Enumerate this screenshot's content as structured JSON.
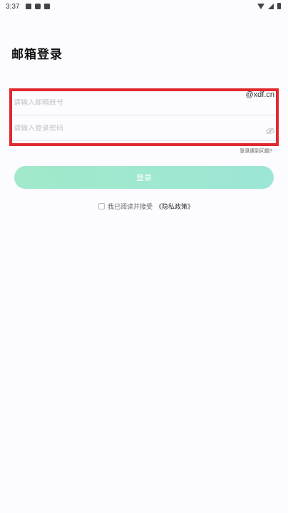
{
  "status_bar": {
    "time": "3:37",
    "left_icons": [
      "gallery-icon",
      "notification-icon",
      "sim-icon"
    ],
    "right_icons": [
      "wifi-icon",
      "signal-icon",
      "battery-icon"
    ]
  },
  "header": {
    "title": "邮箱登录"
  },
  "form": {
    "email_placeholder": "请输入邮箱账号",
    "email_value": "",
    "email_suffix": "@xdf.cn",
    "password_placeholder": "请输入登录密码",
    "password_value": "",
    "password_toggle_icon": "eye-off-icon",
    "trouble_link": "登录遇到问题?",
    "submit_label": "登录"
  },
  "agreement": {
    "text": "我已阅读并接受",
    "privacy_link": "《隐私政策》",
    "checked": false
  },
  "colors": {
    "highlight": "#e0282e",
    "button_start": "#92e6c1",
    "button_end": "#8ce3cf",
    "background": "#fcfbff"
  }
}
